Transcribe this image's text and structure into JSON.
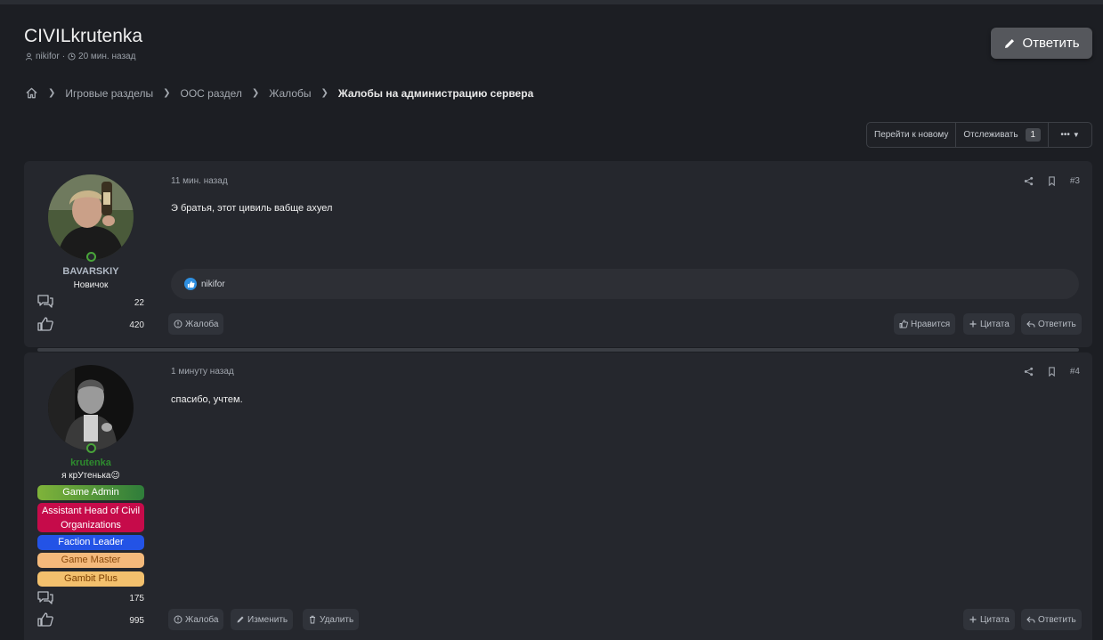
{
  "thread": {
    "title": "CIVILkrutenka",
    "author": "nikifor",
    "time": "20 мин. назад",
    "reply_label": "Ответить"
  },
  "breadcrumb": {
    "items": [
      "Игровые разделы",
      "ООС раздел",
      "Жалобы"
    ],
    "current": "Жалобы на администрацию сервера"
  },
  "toolbar": {
    "goto_new": "Перейти к новому",
    "watch": "Отслеживать",
    "watch_count": "1",
    "more": "•••"
  },
  "posts": [
    {
      "username": "BAVARSKIY",
      "user_title": "Новичок",
      "messages": "22",
      "reactions": "420",
      "date": "11 мин. назад",
      "number": "#3",
      "body": "Э братья, этот цивиль вабще ахуел",
      "liked_by": "nikifor",
      "actions_left": [
        "Жалоба"
      ],
      "actions_right": [
        "Нравится",
        "Цитата",
        "Ответить"
      ]
    },
    {
      "username": "krutenka",
      "user_title": "я крУтенька😉",
      "badges": [
        "Game Admin",
        "Assistant Head of Civil Organizations",
        "Faction Leader",
        "Game Master",
        "Gambit Plus"
      ],
      "messages": "175",
      "reactions": "995",
      "date": "1 минуту назад",
      "number": "#4",
      "body": "спасибо, учтем.",
      "actions_left": [
        "Жалоба",
        "Изменить",
        "Удалить"
      ],
      "actions_right": [
        "Цитата",
        "Ответить"
      ]
    }
  ],
  "colors": {
    "background": "#1c1e23",
    "post_bg": "#25272d",
    "admin_name": "#2e8b2e",
    "like_blue": "#2e8fe0"
  }
}
